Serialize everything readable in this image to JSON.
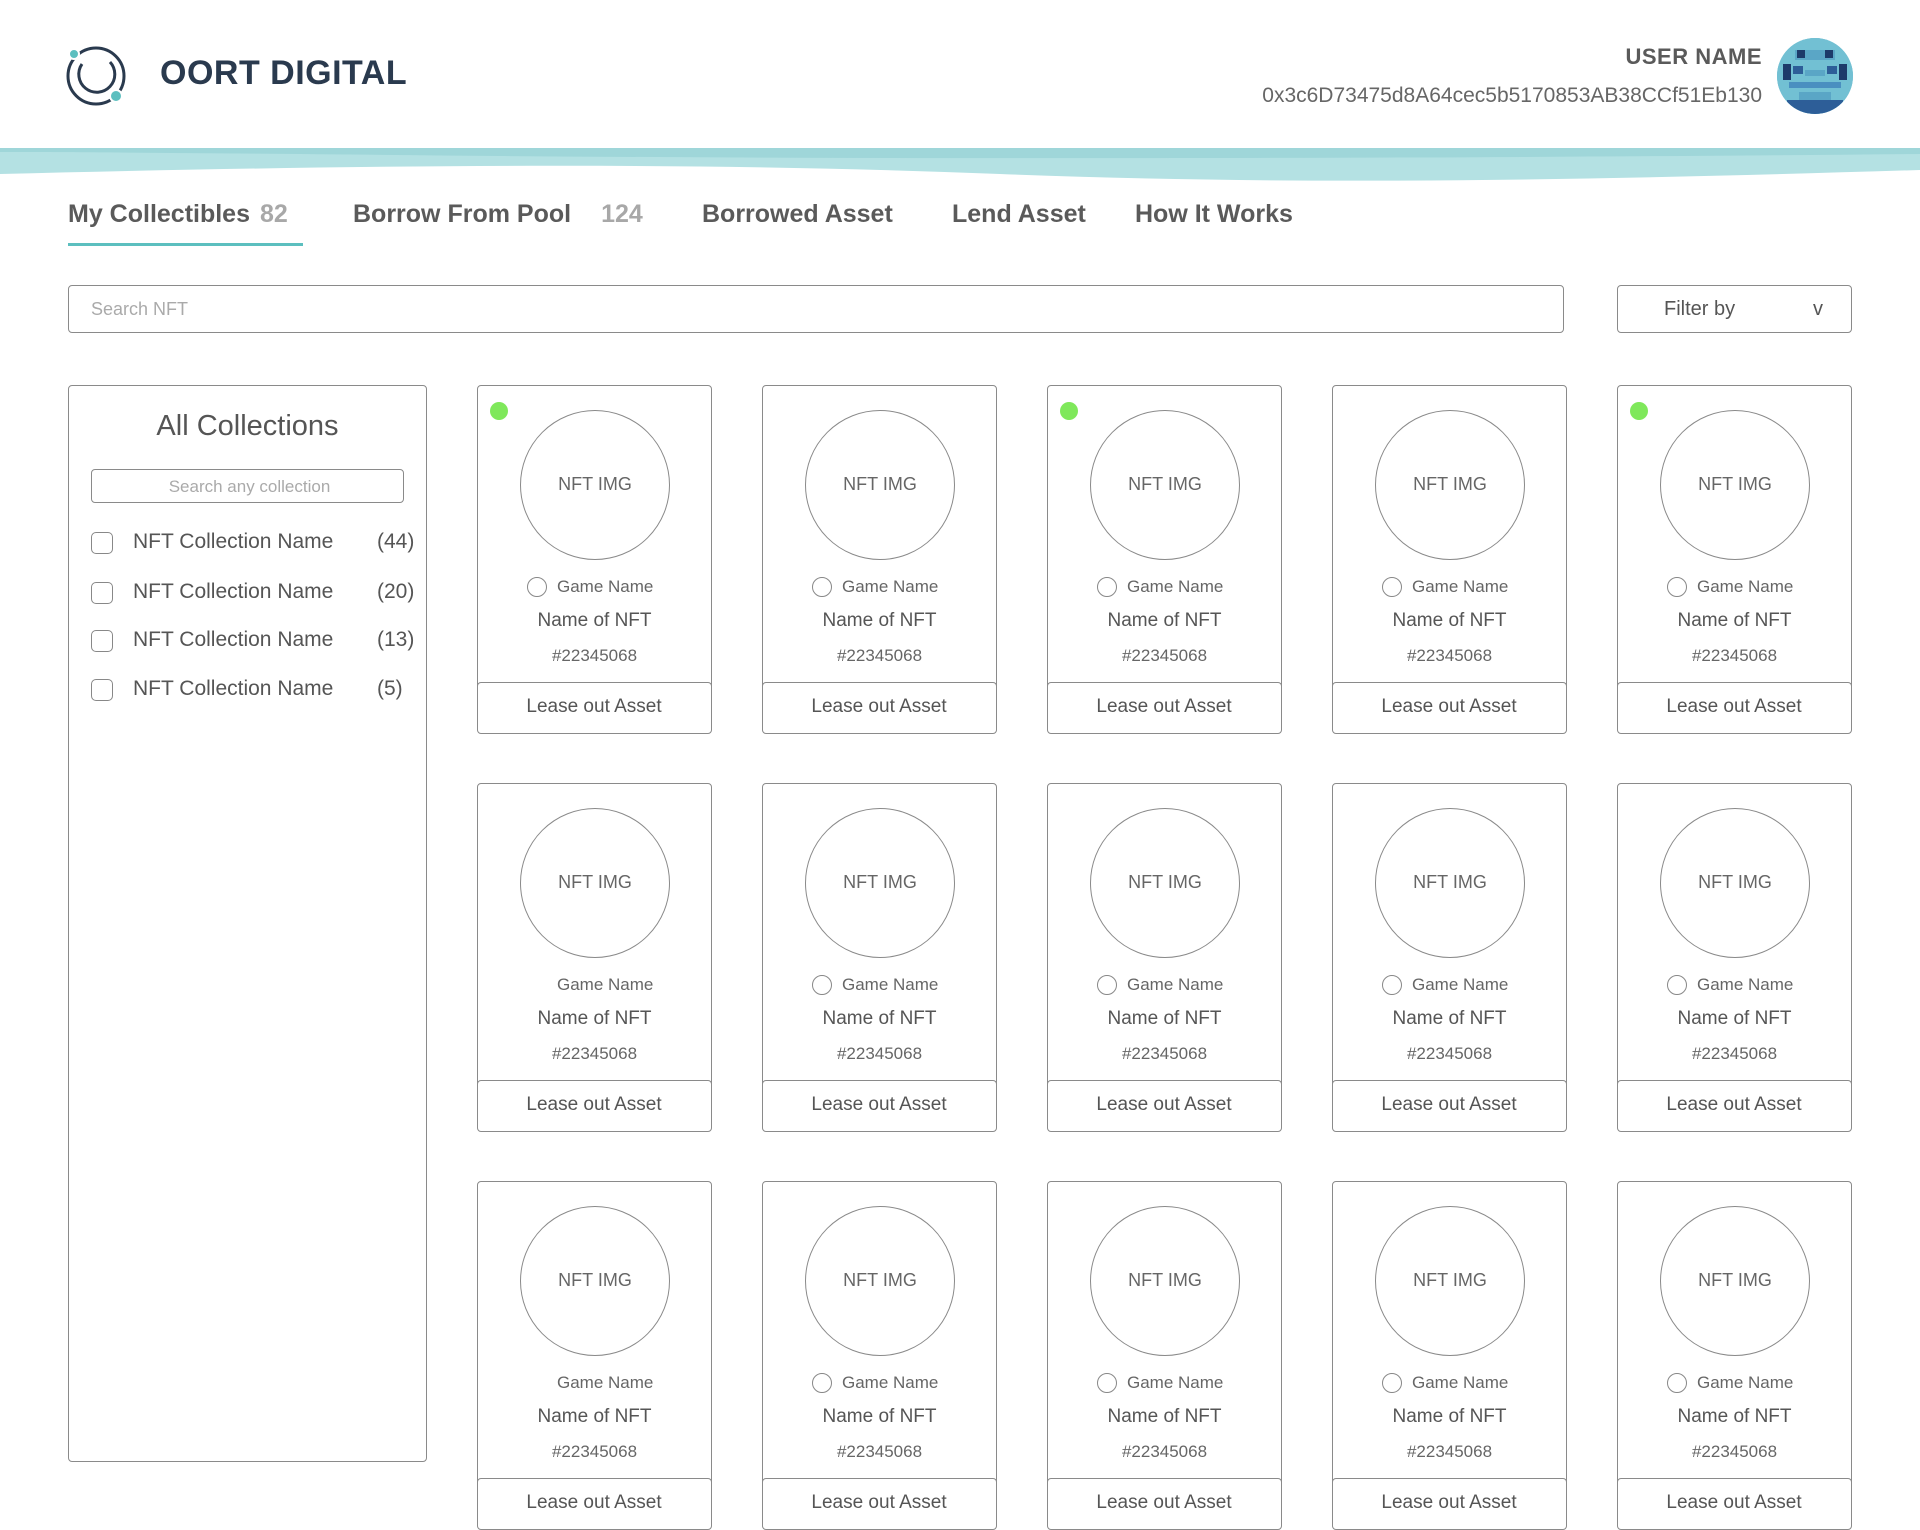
{
  "header": {
    "brand": "OORT DIGITAL",
    "user_name": "USER NAME",
    "wallet_address": "0x3c6D73475d8A64cec5b5170853AB38CCf51Eb130",
    "accent_color": "#5cbfbf",
    "wave_color": "#b4e1e3"
  },
  "tabs": [
    {
      "label": "My Collectibles",
      "count": "82",
      "active": true
    },
    {
      "label": "Borrow From Pool",
      "count": "124"
    },
    {
      "label": "Borrowed Asset"
    },
    {
      "label": "Lend Asset"
    },
    {
      "label": "How It Works"
    }
  ],
  "search": {
    "placeholder": "Search NFT"
  },
  "filter": {
    "label": "Filter by",
    "chevron": "v"
  },
  "sidebar": {
    "title": "All Collections",
    "search_placeholder": "Search any collection",
    "collections": [
      {
        "name": "NFT Collection Name",
        "count": "(44)"
      },
      {
        "name": "NFT Collection Name",
        "count": "(20)"
      },
      {
        "name": "NFT Collection Name",
        "count": "(13)"
      },
      {
        "name": "NFT Collection Name",
        "count": "(5)"
      }
    ]
  },
  "cards": [
    {
      "image_label": "NFT IMG",
      "game": "Game Name",
      "name": "Name of NFT",
      "id": "#22345068",
      "button": "Lease out Asset",
      "status_dot": true,
      "radio": true
    },
    {
      "image_label": "NFT IMG",
      "game": "Game Name",
      "name": "Name of NFT",
      "id": "#22345068",
      "button": "Lease out Asset",
      "status_dot": false,
      "radio": true
    },
    {
      "image_label": "NFT IMG",
      "game": "Game Name",
      "name": "Name of NFT",
      "id": "#22345068",
      "button": "Lease out Asset",
      "status_dot": true,
      "radio": true
    },
    {
      "image_label": "NFT IMG",
      "game": "Game Name",
      "name": "Name of NFT",
      "id": "#22345068",
      "button": "Lease out Asset",
      "status_dot": false,
      "radio": true
    },
    {
      "image_label": "NFT IMG",
      "game": "Game Name",
      "name": "Name of NFT",
      "id": "#22345068",
      "button": "Lease out Asset",
      "status_dot": true,
      "radio": true
    },
    {
      "image_label": "NFT IMG",
      "game": "Game Name",
      "name": "Name of NFT",
      "id": "#22345068",
      "button": "Lease out Asset",
      "status_dot": false,
      "radio": false
    },
    {
      "image_label": "NFT IMG",
      "game": "Game Name",
      "name": "Name of NFT",
      "id": "#22345068",
      "button": "Lease out Asset",
      "status_dot": false,
      "radio": true
    },
    {
      "image_label": "NFT IMG",
      "game": "Game Name",
      "name": "Name of NFT",
      "id": "#22345068",
      "button": "Lease out Asset",
      "status_dot": false,
      "radio": true
    },
    {
      "image_label": "NFT IMG",
      "game": "Game Name",
      "name": "Name of NFT",
      "id": "#22345068",
      "button": "Lease out Asset",
      "status_dot": false,
      "radio": true
    },
    {
      "image_label": "NFT IMG",
      "game": "Game Name",
      "name": "Name of NFT",
      "id": "#22345068",
      "button": "Lease out Asset",
      "status_dot": false,
      "radio": true
    },
    {
      "image_label": "NFT IMG",
      "game": "Game Name",
      "name": "Name of NFT",
      "id": "#22345068",
      "button": "Lease out Asset",
      "status_dot": false,
      "radio": false
    },
    {
      "image_label": "NFT IMG",
      "game": "Game Name",
      "name": "Name of NFT",
      "id": "#22345068",
      "button": "Lease out Asset",
      "status_dot": false,
      "radio": true
    },
    {
      "image_label": "NFT IMG",
      "game": "Game Name",
      "name": "Name of NFT",
      "id": "#22345068",
      "button": "Lease out Asset",
      "status_dot": false,
      "radio": true
    },
    {
      "image_label": "NFT IMG",
      "game": "Game Name",
      "name": "Name of NFT",
      "id": "#22345068",
      "button": "Lease out Asset",
      "status_dot": false,
      "radio": true
    },
    {
      "image_label": "NFT IMG",
      "game": "Game Name",
      "name": "Name of NFT",
      "id": "#22345068",
      "button": "Lease out Asset",
      "status_dot": false,
      "radio": true
    }
  ]
}
